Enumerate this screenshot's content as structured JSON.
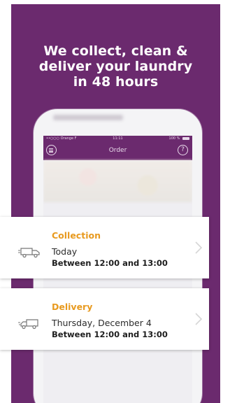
{
  "headline": {
    "line1": "We collect, clean &",
    "line2": "deliver your laundry",
    "line3": "in 48 hours"
  },
  "phone": {
    "status": {
      "carrier": "••○○○ Orange F",
      "time": "11:11",
      "battery": "100 %"
    },
    "nav": {
      "title": "Order",
      "menu_icon": "menu-icon",
      "help_icon": "help-icon",
      "help_glyph": "?"
    }
  },
  "collection": {
    "title": "Collection",
    "day": "Today",
    "time_slot": "Between 12:00 and 13:00",
    "icon": "van-icon"
  },
  "delivery": {
    "title": "Delivery",
    "day": "Thursday, December 4",
    "time_slot": "Between 12:00 and 13:00",
    "icon": "van-icon"
  },
  "colors": {
    "brand_purple": "#6b2a6e",
    "accent_orange": "#e89a1f"
  }
}
